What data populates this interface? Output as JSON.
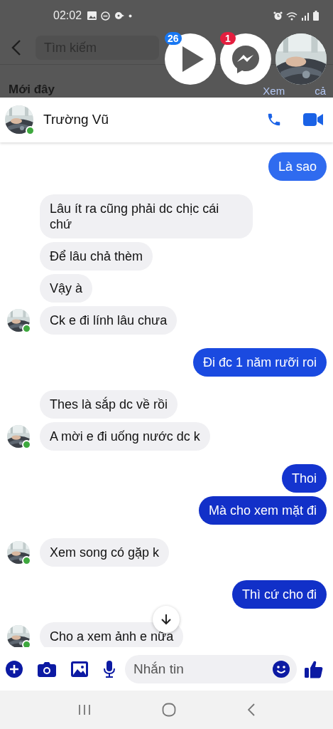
{
  "status_bar": {
    "time": "02:02"
  },
  "background_page": {
    "search": {
      "placeholder": "Tìm kiếm"
    },
    "section_title": "Mới đây",
    "see_all": [
      "Xem",
      "cả"
    ]
  },
  "chat_heads": [
    {
      "kind": "video",
      "badge": "26"
    },
    {
      "kind": "messenger",
      "badge": "1"
    },
    {
      "kind": "contact"
    }
  ],
  "conversation": {
    "name": "Trường Vũ",
    "online": true
  },
  "groups": [
    {
      "kind": "outgoing",
      "messages": [
        {
          "text": "Là sao",
          "color": "#2f6bef"
        }
      ]
    },
    {
      "kind": "incoming",
      "avatar": true,
      "messages": [
        {
          "text": "Lâu ít ra cũng phải dc chịc cái chứ"
        },
        {
          "text": "Để lâu chả thèm"
        },
        {
          "text": "Vậy à"
        },
        {
          "text": "Ck e đi lính lâu chưa"
        }
      ]
    },
    {
      "kind": "outgoing",
      "messages": [
        {
          "text": "Đi đc 1 năm rưỡi roi",
          "color": "#1a4ae0"
        }
      ]
    },
    {
      "kind": "incoming",
      "avatar": true,
      "messages": [
        {
          "text": "Thes là sắp dc về rồi"
        },
        {
          "text": "A mời e đi uống nước dc k"
        }
      ]
    },
    {
      "kind": "outgoing",
      "messages": [
        {
          "text": "Thoi",
          "color": "#1434cf"
        },
        {
          "text": "Mà cho xem mặt đi",
          "color": "#1230c8"
        }
      ]
    },
    {
      "kind": "incoming",
      "avatar": true,
      "messages": [
        {
          "text": "Xem song có gặp k"
        }
      ]
    },
    {
      "kind": "outgoing",
      "messages": [
        {
          "text": "Thì cứ cho đi",
          "color": "#1130c8"
        }
      ]
    },
    {
      "kind": "incoming",
      "avatar": true,
      "messages": [
        {
          "text": "Cho a xem ảnh e nữa"
        }
      ]
    }
  ],
  "composer": {
    "placeholder": "Nhắn tin"
  }
}
